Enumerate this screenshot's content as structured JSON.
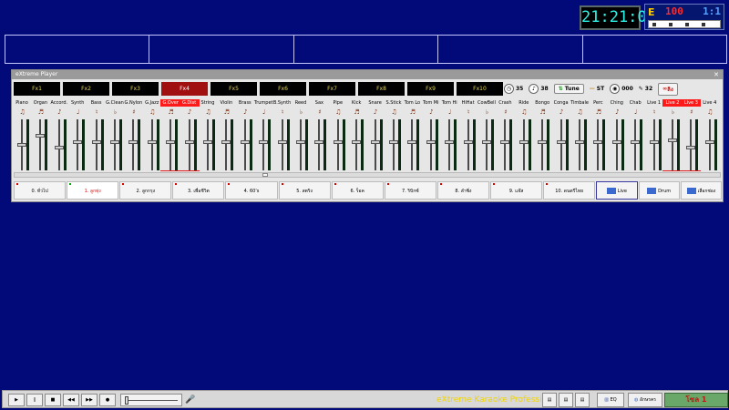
{
  "clock": "21:21:07",
  "energy": {
    "label": "E",
    "value": "100",
    "ratio": "1:1"
  },
  "window": {
    "title": "eXtreme Player"
  },
  "fx": [
    {
      "label": "Fx1",
      "active": false
    },
    {
      "label": "Fx2",
      "active": false
    },
    {
      "label": "Fx3",
      "active": false
    },
    {
      "label": "Fx4",
      "active": true
    },
    {
      "label": "Fx5",
      "active": false
    },
    {
      "label": "Fx6",
      "active": false
    },
    {
      "label": "Fx7",
      "active": false
    },
    {
      "label": "Fx8",
      "active": false
    },
    {
      "label": "Fx9",
      "active": false
    },
    {
      "label": "Fx10",
      "active": false
    }
  ],
  "controls": {
    "tempo": "35",
    "key": "38",
    "tune": "Tune",
    "st": "ST",
    "counter": "000",
    "guitar_val": "32",
    "mode_label": "ลิง"
  },
  "channels": [
    {
      "label": "Piano",
      "level": 0.5
    },
    {
      "label": "Organ",
      "level": 0.7
    },
    {
      "label": "Accord.",
      "level": 0.45
    },
    {
      "label": "Synth",
      "level": 0.55
    },
    {
      "label": "Bass",
      "level": 0.55
    },
    {
      "label": "G.Clean",
      "level": 0.55
    },
    {
      "label": "G.Nylon",
      "level": 0.55
    },
    {
      "label": "G.Jazz",
      "level": 0.55
    },
    {
      "label": "G.Over",
      "level": 0.55,
      "hl": true
    },
    {
      "label": "G.Dist",
      "level": 0.55,
      "hl": true
    },
    {
      "label": "String",
      "level": 0.55
    },
    {
      "label": "Violin",
      "level": 0.55
    },
    {
      "label": "Brass",
      "level": 0.55
    },
    {
      "label": "Trumpet",
      "level": 0.55
    },
    {
      "label": "B.Synth",
      "level": 0.55
    },
    {
      "label": "Reed",
      "level": 0.55
    },
    {
      "label": "Sax",
      "level": 0.55
    },
    {
      "label": "Pipe",
      "level": 0.55
    },
    {
      "label": "Kick",
      "level": 0.55
    },
    {
      "label": "Snare",
      "level": 0.55
    },
    {
      "label": "S.Stick",
      "level": 0.55
    },
    {
      "label": "Tom Lo",
      "level": 0.55
    },
    {
      "label": "Tom Mi",
      "level": 0.55
    },
    {
      "label": "Tom Hi",
      "level": 0.55
    },
    {
      "label": "HiHat",
      "level": 0.55
    },
    {
      "label": "CowBell",
      "level": 0.55
    },
    {
      "label": "Crash",
      "level": 0.55
    },
    {
      "label": "Ride",
      "level": 0.55
    },
    {
      "label": "Bongo",
      "level": 0.55
    },
    {
      "label": "Conga",
      "level": 0.55
    },
    {
      "label": "Timbale",
      "level": 0.55
    },
    {
      "label": "Perc",
      "level": 0.55
    },
    {
      "label": "Ching",
      "level": 0.55
    },
    {
      "label": "Chab",
      "level": 0.55
    },
    {
      "label": "Live 1",
      "level": 0.55
    },
    {
      "label": "Live 2",
      "level": 0.6,
      "hl": true
    },
    {
      "label": "Live 3",
      "level": 0.45,
      "hl": true
    },
    {
      "label": "Live 4",
      "level": 0.55
    }
  ],
  "styles": [
    {
      "label": "0. ทั่วไป",
      "active": false
    },
    {
      "label": "1. ลูกทุ่ง",
      "active": true
    },
    {
      "label": "2. ลูกกรุง",
      "active": false
    },
    {
      "label": "3. เพื่อชีวิต",
      "active": false
    },
    {
      "label": "4. 60's",
      "active": false
    },
    {
      "label": "5. สตริง",
      "active": false
    },
    {
      "label": "6. ร็อค",
      "active": false
    },
    {
      "label": "7. ริบิกซ์",
      "active": false
    },
    {
      "label": "8. ลำซิ่ง",
      "active": false
    },
    {
      "label": "9. แจ๊ส",
      "active": false
    },
    {
      "label": "10. ดนตรีไทย",
      "active": false
    }
  ],
  "modes": {
    "live": "Live",
    "drum": "Drum",
    "select": "เลือกช่อง"
  },
  "bottom": {
    "play": "▶",
    "pause": "∥",
    "stop": "■",
    "prev": "◀◀",
    "next": "▶▶",
    "rec": "●",
    "marquee": "eXtreme Karaoke Professional",
    "eq": "EQ",
    "karaoke": "อักษรคร",
    "ending": "โซล 1"
  }
}
